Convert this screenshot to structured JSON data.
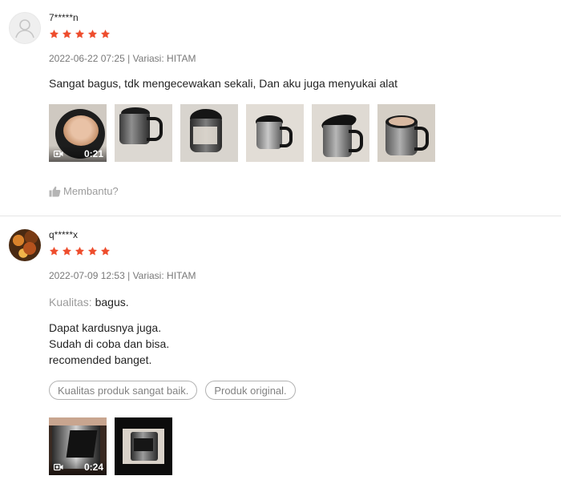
{
  "colors": {
    "star": "#ee4d2d",
    "divider": "#e5e5e5",
    "muted_text": "#999999"
  },
  "reviews": [
    {
      "username": "7*****n",
      "rating": 5,
      "date": "2022-06-22 07:25",
      "separator": "|",
      "variation_label": "Variasi:",
      "variation": "HITAM",
      "comment": "Sangat bagus, tdk mengecewakan sekali, Dan aku juga menyukai alat",
      "media": [
        {
          "type": "video",
          "duration": "0:21",
          "icon": "video-camera-icon"
        },
        {
          "type": "image"
        },
        {
          "type": "image"
        },
        {
          "type": "image"
        },
        {
          "type": "image"
        },
        {
          "type": "image"
        }
      ],
      "helpful_label": "Membantu?",
      "helpful_icon": "thumbs-up-icon"
    },
    {
      "username": "q*****x",
      "rating": 5,
      "date": "2022-07-09 12:53",
      "separator": "|",
      "variation_label": "Variasi:",
      "variation": "HITAM",
      "quality_label": "Kualitas:",
      "quality_value": "bagus.",
      "comment_lines": [
        "Dapat kardusnya juga.",
        "Sudah di coba dan bisa.",
        "recomended banget."
      ],
      "tags": [
        "Kualitas produk sangat baik.",
        "Produk original."
      ],
      "media": [
        {
          "type": "video",
          "duration": "0:24",
          "icon": "video-camera-icon"
        },
        {
          "type": "image"
        }
      ]
    }
  ]
}
